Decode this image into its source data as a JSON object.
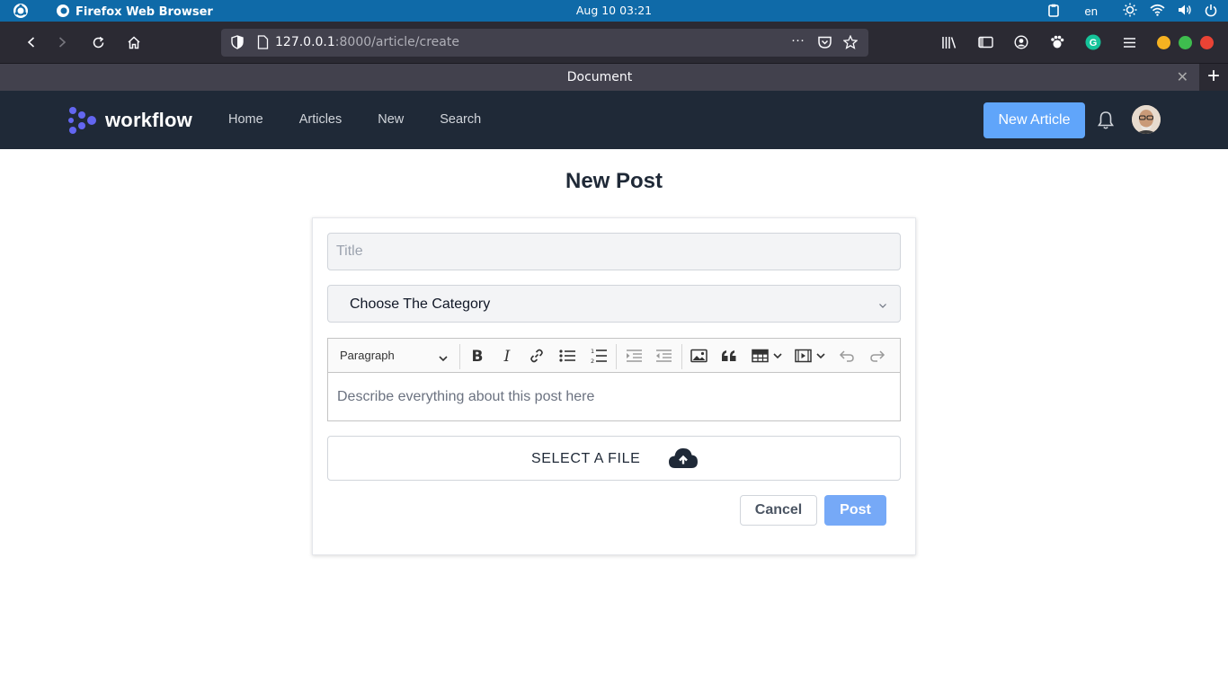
{
  "os": {
    "app_name": "Firefox Web Browser",
    "clock": "Aug 10  03:21",
    "lang": "en"
  },
  "browser": {
    "url_host": "127.0.0.1",
    "url_rest": ":8000/article/create",
    "tab_title": "Document",
    "window_buttons": {
      "minimize": "#f6b221",
      "maximize": "#3ebd4e",
      "close": "#ea4335"
    }
  },
  "nav": {
    "brand": "workflow",
    "links": [
      "Home",
      "Articles",
      "New",
      "Search"
    ],
    "new_article_label": "New Article",
    "accent": "#60a5fa"
  },
  "page": {
    "title": "New Post",
    "title_placeholder": "Title",
    "category_value": "Choose The Category",
    "editor": {
      "block_style": "Paragraph",
      "placeholder": "Describe everything about this post here"
    },
    "file_label": "SELECT A FILE",
    "cancel_label": "Cancel",
    "post_label": "Post"
  }
}
